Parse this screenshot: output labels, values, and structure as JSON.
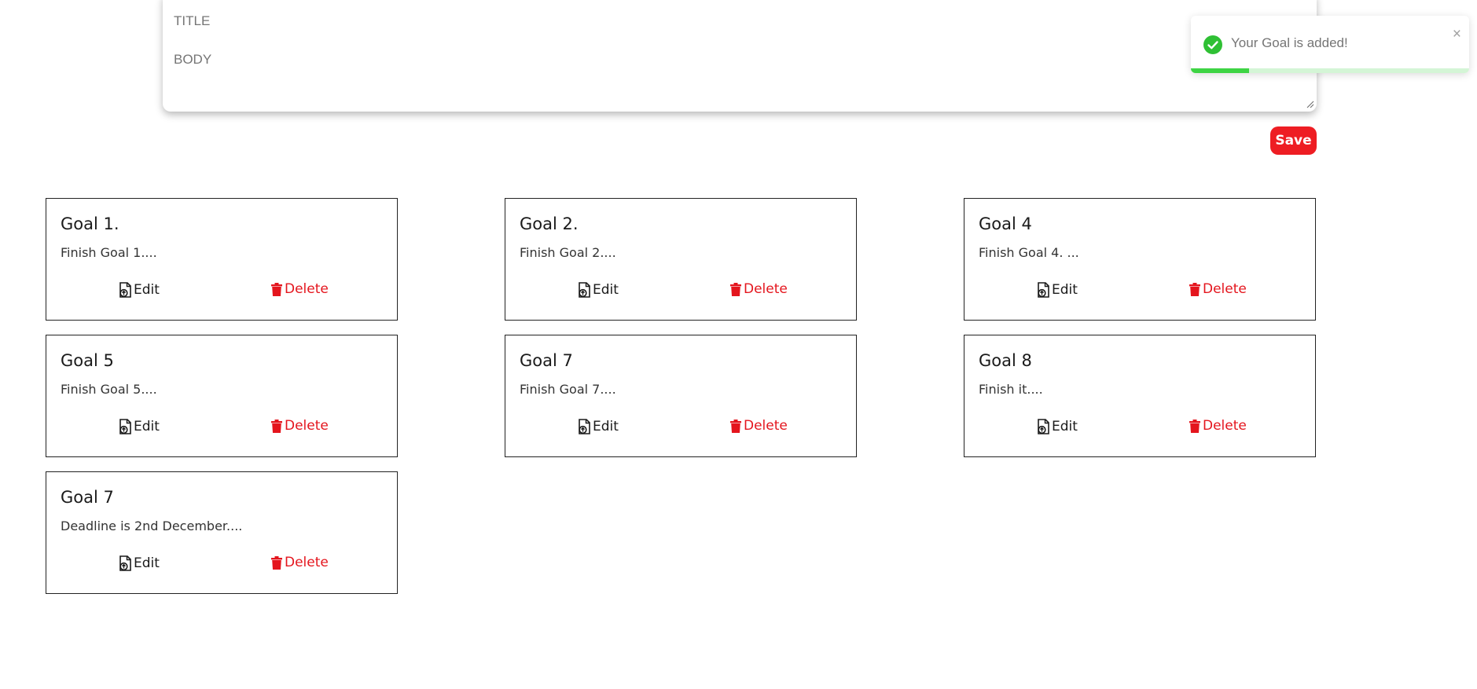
{
  "form": {
    "title_placeholder": "TITLE",
    "body_placeholder": "BODY",
    "save_label": "Save"
  },
  "toast": {
    "message": "Your Goal is added!",
    "close_glyph": "×",
    "icon": "check-circle-icon",
    "progress": 0.21,
    "accent_color": "#2fc034"
  },
  "goals": [
    {
      "title": "Goal 1.",
      "body": "Finish Goal 1....",
      "edit_label": "Edit",
      "delete_label": "Delete"
    },
    {
      "title": "Goal 2.",
      "body": "Finish Goal 2....",
      "edit_label": "Edit",
      "delete_label": "Delete"
    },
    {
      "title": "Goal 4",
      "body": "Finish Goal 4. ...",
      "edit_label": "Edit",
      "delete_label": "Delete"
    },
    {
      "title": "Goal 5",
      "body": "Finish Goal 5....",
      "edit_label": "Edit",
      "delete_label": "Delete"
    },
    {
      "title": "Goal 7",
      "body": "Finish Goal 7....",
      "edit_label": "Edit",
      "delete_label": "Delete"
    },
    {
      "title": "Goal 8",
      "body": "Finish it....",
      "edit_label": "Edit",
      "delete_label": "Delete"
    },
    {
      "title": "Goal 7",
      "body": "Deadline is 2nd December....",
      "edit_label": "Edit",
      "delete_label": "Delete"
    }
  ],
  "colors": {
    "save_button": "#ee1d23",
    "delete_text": "#e4151d",
    "card_border": "#222222"
  }
}
